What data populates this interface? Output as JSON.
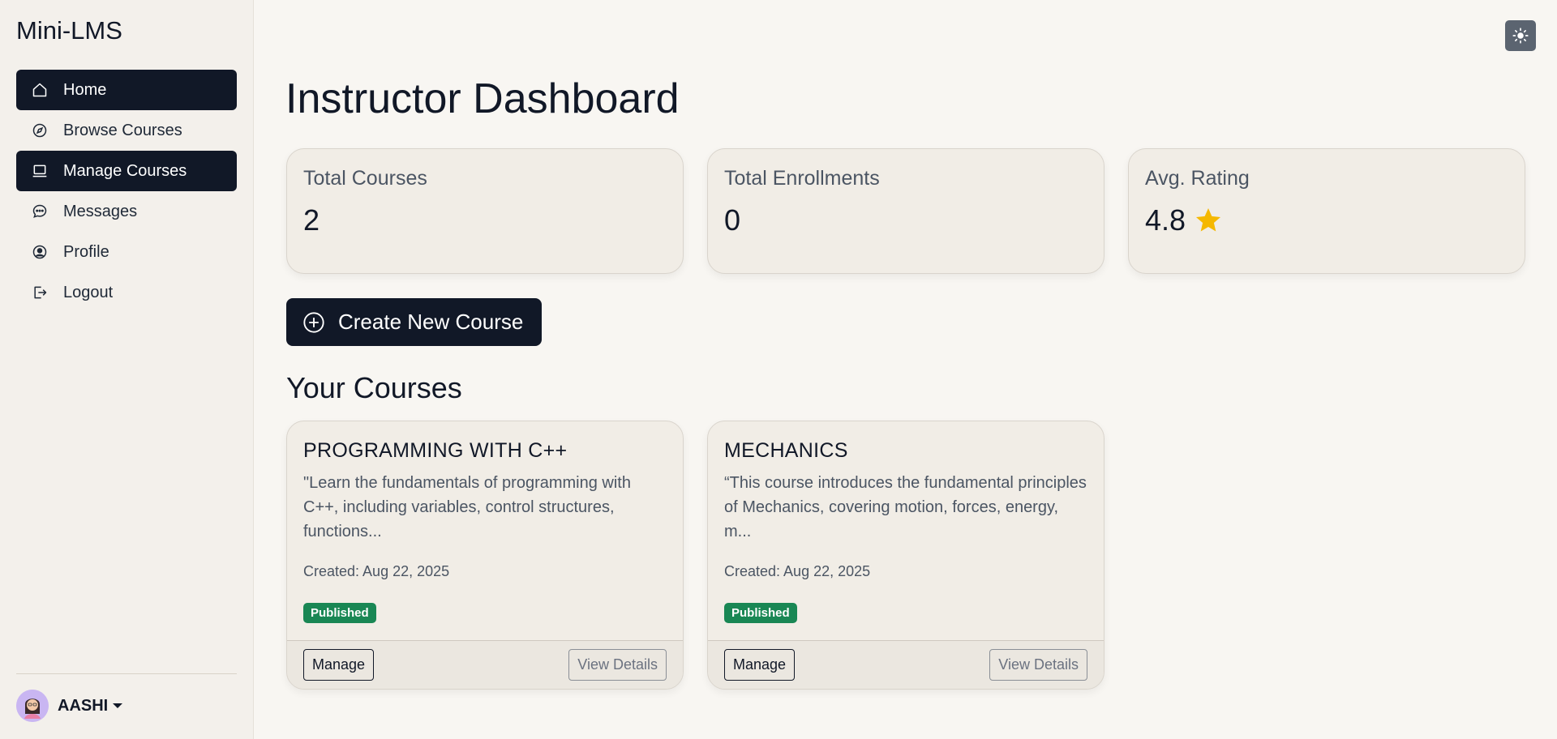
{
  "app": {
    "brand": "Mini-LMS"
  },
  "sidebar": {
    "items": [
      {
        "label": "Home",
        "icon": "home-icon",
        "active": true
      },
      {
        "label": "Browse Courses",
        "icon": "compass-icon",
        "active": false
      },
      {
        "label": "Manage Courses",
        "icon": "monitor-icon",
        "active": true
      },
      {
        "label": "Messages",
        "icon": "chat-icon",
        "active": false
      },
      {
        "label": "Profile",
        "icon": "user-circle-icon",
        "active": false
      },
      {
        "label": "Logout",
        "icon": "logout-icon",
        "active": false
      }
    ],
    "user": {
      "name": "AASHI"
    }
  },
  "header": {
    "theme_toggle_icon": "sun-icon"
  },
  "main": {
    "title": "Instructor Dashboard",
    "stats": [
      {
        "label": "Total Courses",
        "value": "2"
      },
      {
        "label": "Total Enrollments",
        "value": "0"
      },
      {
        "label": "Avg. Rating",
        "value": "4.8",
        "icon": "star-icon"
      }
    ],
    "create_button": "Create New Course",
    "section_title": "Your Courses",
    "courses": [
      {
        "title": "PROGRAMMING WITH C++",
        "description": "\"Learn the fundamentals of programming with C++, including variables, control structures, functions...",
        "created": "Created: Aug 22, 2025",
        "status": "Published",
        "manage_label": "Manage",
        "details_label": "View Details"
      },
      {
        "title": "MECHANICS",
        "description": "“This course introduces the fundamental principles of Mechanics, covering motion, forces, energy, m...",
        "created": "Created: Aug 22, 2025",
        "status": "Published",
        "manage_label": "Manage",
        "details_label": "View Details"
      }
    ]
  },
  "colors": {
    "primary": "#111827",
    "background": "#f8f6f2",
    "sidebar_bg": "#f3f0eb",
    "card_bg": "#f1ede6",
    "success": "#198754",
    "star": "#f5b800"
  }
}
